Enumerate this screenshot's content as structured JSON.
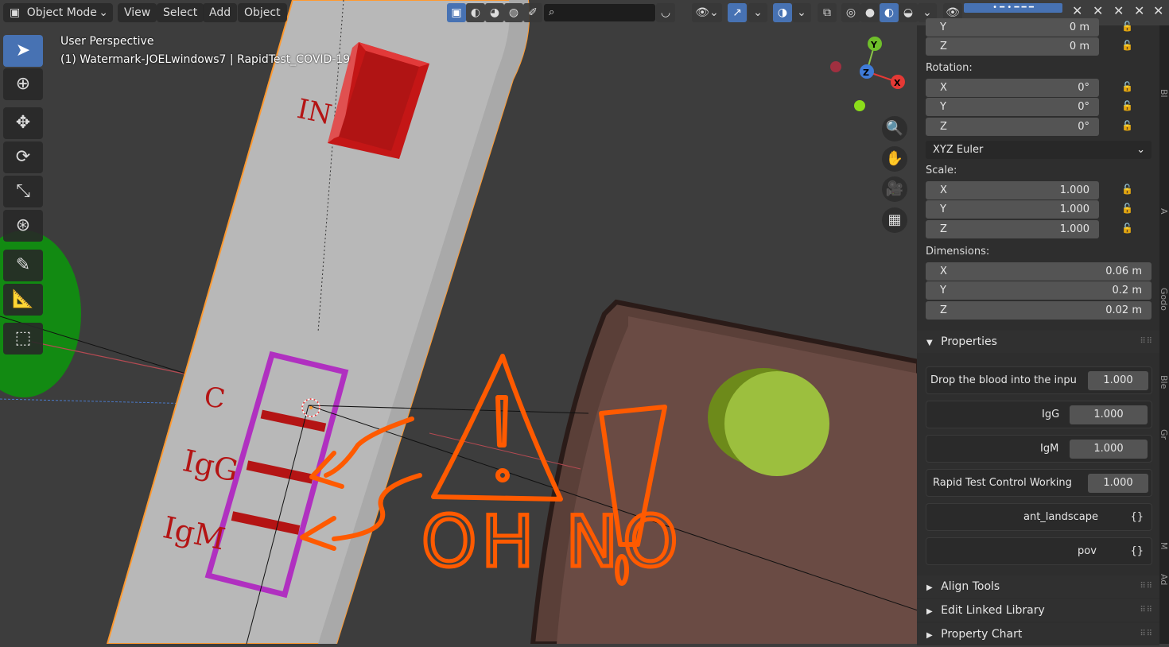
{
  "header": {
    "mode": "Object Mode",
    "menus": [
      "View",
      "Select",
      "Add",
      "Object"
    ]
  },
  "viewport": {
    "view_name": "User Perspective",
    "object_info": "(1) Watermark-JOELwindows7 | RapidTest_COVID-19",
    "labels": {
      "in": "IN",
      "c": "C",
      "igg": "IgG",
      "igm": "IgM",
      "oh_no": "OH NO"
    },
    "gizmo": {
      "y": "Y",
      "z": "Z",
      "x": "X"
    }
  },
  "panel": {
    "location_y_label": "Y",
    "location_y": "0 m",
    "location_z_label": "Z",
    "location_z": "0 m",
    "rotation_label": "Rotation:",
    "rotation": [
      {
        "axis": "X",
        "value": "0°"
      },
      {
        "axis": "Y",
        "value": "0°"
      },
      {
        "axis": "Z",
        "value": "0°"
      }
    ],
    "rotation_mode": "XYZ Euler",
    "scale_label": "Scale:",
    "scale": [
      {
        "axis": "X",
        "value": "1.000"
      },
      {
        "axis": "Y",
        "value": "1.000"
      },
      {
        "axis": "Z",
        "value": "1.000"
      }
    ],
    "dimensions_label": "Dimensions:",
    "dimensions": [
      {
        "axis": "X",
        "value": "0.06 m"
      },
      {
        "axis": "Y",
        "value": "0.2 m"
      },
      {
        "axis": "Z",
        "value": "0.02 m"
      }
    ],
    "properties_title": "Properties",
    "properties": [
      {
        "label": "Drop the blood into the inpu",
        "value": "1.000"
      },
      {
        "label": "IgG",
        "value": "1.000"
      },
      {
        "label": "IgM",
        "value": "1.000"
      },
      {
        "label": "Rapid Test Control Working",
        "value": "1.000"
      },
      {
        "label": "ant_landscape",
        "value": "{}"
      },
      {
        "label": "pov",
        "value": "{}"
      }
    ],
    "collapsed_sections": [
      "Align Tools",
      "Edit Linked Library",
      "Property Chart"
    ]
  },
  "tabs": [
    "Bl",
    "A",
    "Godo",
    "Ble",
    "Gr",
    "M",
    "Ad"
  ],
  "colors": {
    "accent": "#4772b3",
    "annotation": "#ff5a00",
    "strip_marker": "#b41414",
    "window_frame": "#b030c0"
  }
}
